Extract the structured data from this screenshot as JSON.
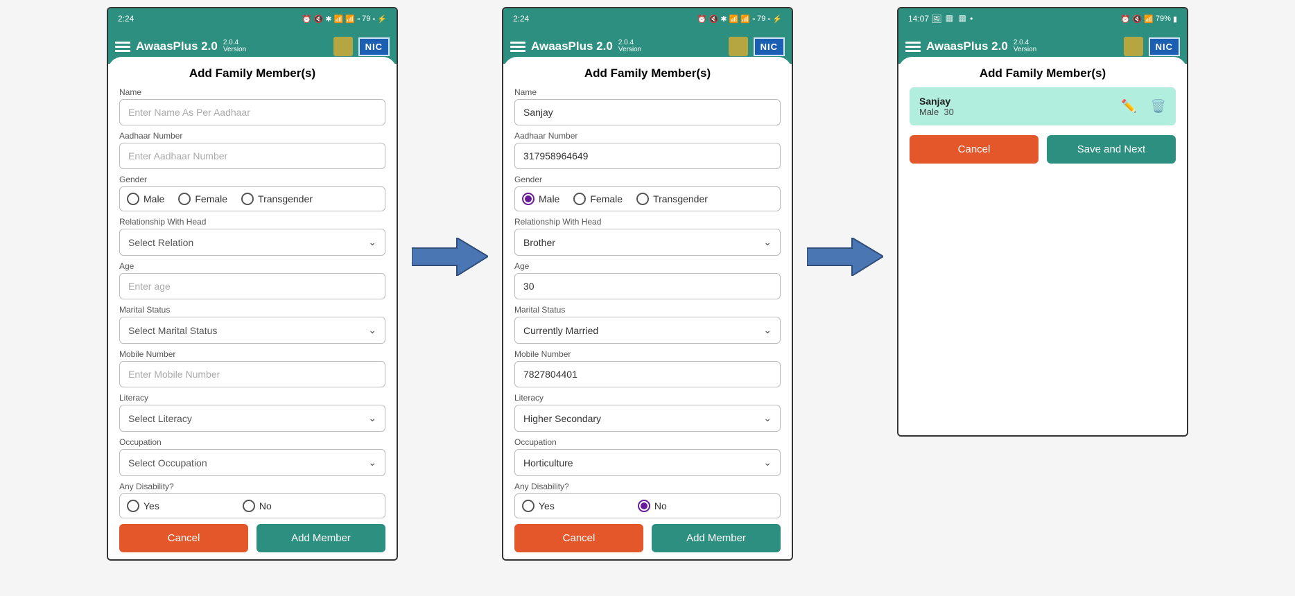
{
  "status": {
    "time_left": "2:24",
    "time_right": "14:07",
    "battery_left": "79",
    "battery_right": "79%"
  },
  "appbar": {
    "title": "AwaasPlus 2.0",
    "version": "2.0.4",
    "version_label": "Version",
    "nic": "NIC"
  },
  "page_title": "Add Family Member(s)",
  "labels": {
    "name": "Name",
    "aadhaar": "Aadhaar Number",
    "gender": "Gender",
    "relation": "Relationship With Head",
    "age": "Age",
    "marital": "Marital Status",
    "mobile": "Mobile Number",
    "literacy": "Literacy",
    "occupation": "Occupation",
    "disability": "Any Disability?"
  },
  "placeholders": {
    "name": "Enter Name As Per Aadhaar",
    "aadhaar": "Enter Aadhaar Number",
    "relation": "Select Relation",
    "age": "Enter age",
    "marital": "Select Marital Status",
    "mobile": "Enter Mobile Number",
    "literacy": "Select Literacy",
    "occupation": "Select Occupation"
  },
  "options": {
    "gender": {
      "male": "Male",
      "female": "Female",
      "trans": "Transgender"
    },
    "yn": {
      "yes": "Yes",
      "no": "No"
    }
  },
  "buttons": {
    "cancel": "Cancel",
    "add": "Add Member",
    "save_next": "Save and Next"
  },
  "screen2": {
    "name": "Sanjay",
    "aadhaar": "317958964649",
    "relation": "Brother",
    "age": "30",
    "marital": "Currently Married",
    "mobile": "7827804401",
    "literacy": "Higher Secondary",
    "occupation": "Horticulture",
    "gender_selected": "male",
    "disability_selected": "no"
  },
  "screen3": {
    "member_name": "Sanjay",
    "member_gender": "Male",
    "member_age": "30"
  }
}
